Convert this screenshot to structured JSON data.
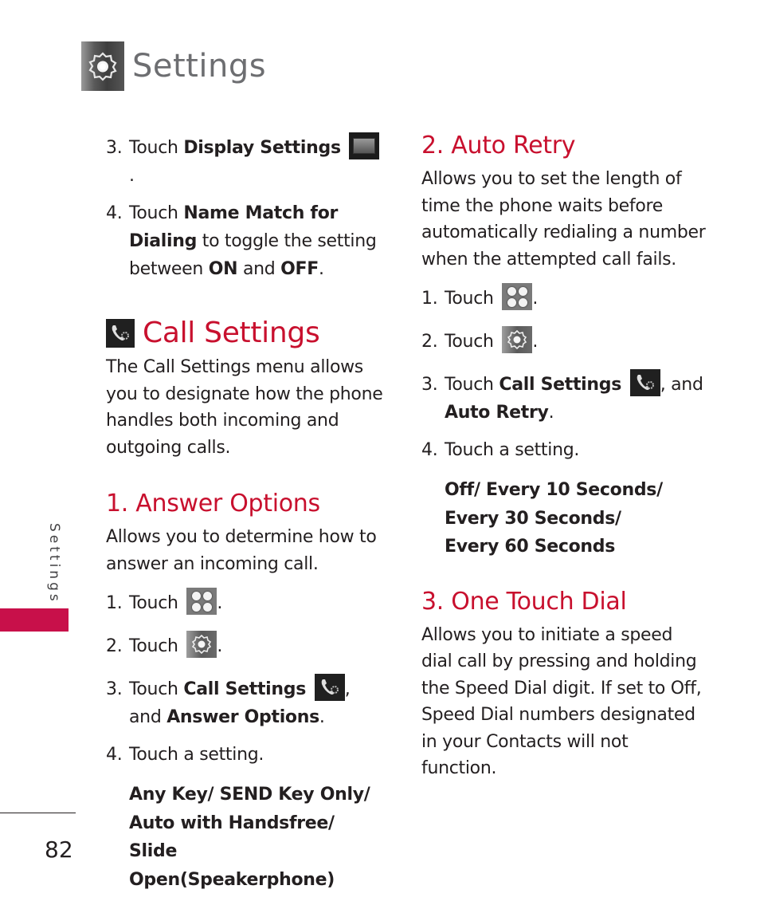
{
  "header": {
    "title": "Settings",
    "icon": "settings-gear-icon"
  },
  "left_column": {
    "steps_top": [
      {
        "num": "3.",
        "parts": [
          {
            "t": "Touch ",
            "b": false
          },
          {
            "t": "Display Settings",
            "b": true
          }
        ],
        "icon": "display-settings-icon",
        "after": "."
      },
      {
        "num": "4.",
        "parts": [
          {
            "t": "Touch ",
            "b": false
          },
          {
            "t": "Name Match for Dialing",
            "b": true
          },
          {
            "t": " to toggle the setting between ",
            "b": false
          },
          {
            "t": "ON",
            "b": true
          },
          {
            "t": " and ",
            "b": false
          },
          {
            "t": "OFF",
            "b": true
          },
          {
            "t": ".",
            "b": false
          }
        ]
      }
    ],
    "section_title": "Call Settings",
    "section_icon": "call-settings-icon",
    "section_intro": "The Call Settings menu allows you to designate how the phone handles both incoming and outgoing calls.",
    "answer_options": {
      "heading": "1. Answer Options",
      "description": "Allows you to determine how to answer an incoming call.",
      "step1": {
        "num": "1.",
        "text": "Touch",
        "icon": "menu-grid-icon",
        "after": "."
      },
      "step2": {
        "num": "2.",
        "text": "Touch",
        "icon": "settings-gear-icon",
        "after": "."
      },
      "step3": {
        "num": "3.",
        "text": "Touch ",
        "bold1": "Call Settings",
        "icon": "call-settings-icon",
        "mid": ", and ",
        "bold2": "Answer Options",
        "after": "."
      },
      "step4": {
        "num": "4.",
        "text": "Touch a setting."
      },
      "options": "Any Key/ SEND Key Only/ Auto with Handsfree/ Slide Open(Speakerphone)"
    }
  },
  "right_column": {
    "auto_retry": {
      "heading": "2. Auto Retry",
      "description": "Allows you to set the length of time the phone waits before automatically redialing a number when the attempted call fails.",
      "step1": {
        "num": "1.",
        "text": "Touch",
        "icon": "menu-grid-icon",
        "after": "."
      },
      "step2": {
        "num": "2.",
        "text": "Touch",
        "icon": "settings-gear-icon",
        "after": "."
      },
      "step3": {
        "num": "3.",
        "text": "Touch ",
        "bold1": "Call Settings",
        "icon": "call-settings-icon",
        "mid": ", and ",
        "bold2": "Auto Retry",
        "after": "."
      },
      "step4": {
        "num": "4.",
        "text": "Touch a setting."
      },
      "options_lines": [
        "Off/ Every 10 Seconds/",
        "Every 30 Seconds/",
        "Every 60 Seconds"
      ]
    },
    "one_touch_dial": {
      "heading": "3. One Touch Dial",
      "description": "Allows you to initiate a speed dial call by pressing and holding the Speed Dial digit. If set to Off, Speed Dial numbers designated in your Contacts will not function."
    }
  },
  "side_tab": {
    "label": "Settings",
    "color": "#c8104a"
  },
  "footer": {
    "page_number": "82"
  },
  "colors": {
    "heading": "#c8102e",
    "title_gray": "#6d6e71",
    "body": "#231f20"
  }
}
